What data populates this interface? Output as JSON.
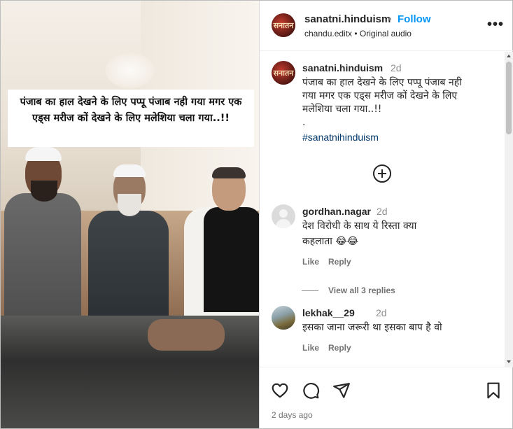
{
  "post": {
    "caption_overlay": "पंजाब का हाल देखने के लिए पप्पू पंजाब नही गया मगर एक एड्स मरीज कों देखने के लिए मलेशिया चला गया..!!"
  },
  "header": {
    "avatar_text": "सनातन",
    "username": "sanatni.hinduism",
    "separator": "•",
    "follow_label": "Follow",
    "subtitle": "chandu.editx • Original audio",
    "more_icon": "more-options-icon"
  },
  "caption": {
    "username": "sanatni.hinduism",
    "time": "2d",
    "line1": "पंजाब का हाल देखने के लिए पप्पू पंजाब नही",
    "line2": "गया मगर एक एड्स मरीज कों देखने के लिए",
    "line3": "मलेशिया चला गया..!!",
    "line4": ".",
    "hashtag": "#sanatnihinduism"
  },
  "comments": [
    {
      "username": "gordhan.nagar",
      "time": "2d",
      "line1": "देश विरोधी के साथ ये रिस्ता क्या",
      "line2": "कहलाता 😂😂",
      "like": "Like",
      "reply": "Reply",
      "view_replies": "View all 3 replies"
    },
    {
      "username": "lekhak__29",
      "time": "2d",
      "line1": "इसका जाना जरूरी था इसका बाप है वो",
      "like": "Like",
      "reply": "Reply"
    }
  ],
  "footer": {
    "time_ago": "2 days ago"
  },
  "colors": {
    "accent": "#0095f6",
    "hashtag": "#00376b",
    "muted": "#737373",
    "text": "#262626"
  }
}
